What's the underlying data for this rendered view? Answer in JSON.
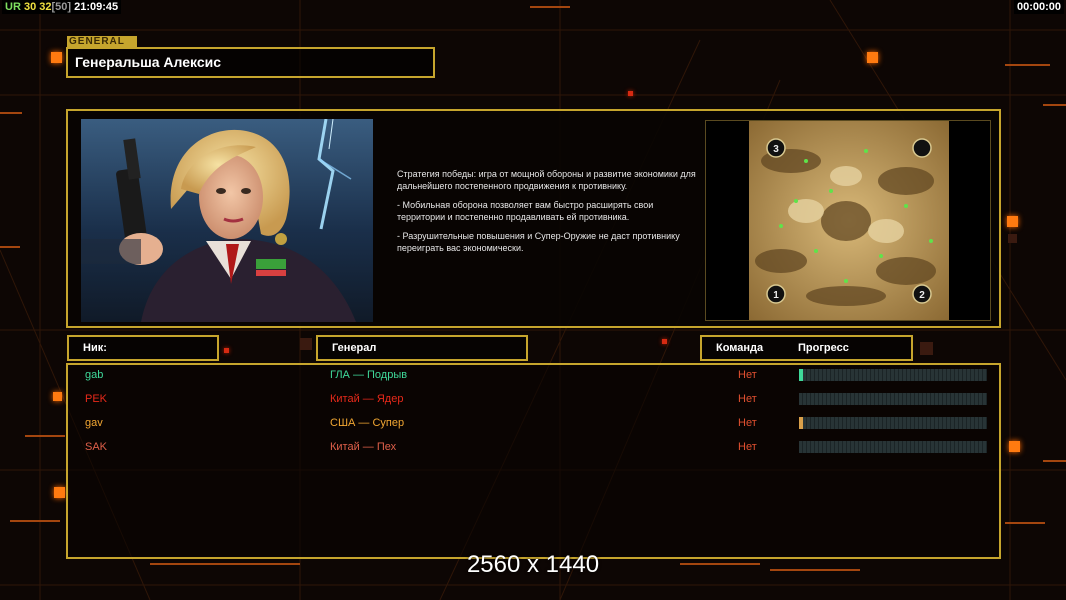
{
  "hud": {
    "left": [
      {
        "text": "UR",
        "cls": "c1"
      },
      {
        "text": " 30",
        "cls": "c2"
      },
      {
        "text": " 32",
        "cls": "c2"
      },
      {
        "text": "[50]",
        "cls": "c3"
      },
      {
        "text": " 21:09:45",
        "cls": "c4"
      }
    ],
    "timer": "00:00:00"
  },
  "general": {
    "tag": "GENERAL",
    "name": "Генеральша Алексис"
  },
  "strategy": [
    "Стратегия победы: игра от мощной обороны и развитие экономики для дальнейшего постепенного продвижения к противнику.",
    "- Мобильная оборона позволяет вам быстро расширять свои территории и постепенно продавливать ей противника.",
    "- Разрушительные повышения и Супер-Оружие не даст противнику переиграть вас экономически."
  ],
  "minimap": {
    "spawns": [
      "3",
      "1",
      "2"
    ]
  },
  "headers": {
    "nick": "Ник:",
    "general": "Генерал",
    "team": "Команда",
    "progress": "Прогресс"
  },
  "players": [
    {
      "nick": "gab",
      "general": "ГЛА — Подрыв",
      "team": "Нет",
      "color": "#3fd99a",
      "progress": 0.02,
      "fill": "#3fd99a"
    },
    {
      "nick": "PEK",
      "general": "Китай — Ядер",
      "team": "Нет",
      "color": "#e8291a",
      "progress": 0.0,
      "fill": "#e8291a"
    },
    {
      "nick": "gav",
      "general": "США — Супер",
      "team": "Нет",
      "color": "#f2a733",
      "progress": 0.02,
      "fill": "#d9a04a"
    },
    {
      "nick": "SAK",
      "general": "Китай — Пех",
      "team": "Нет",
      "color": "#e0604a",
      "progress": 0.0,
      "fill": "#e0604a"
    }
  ],
  "resolution": "2560 x 1440"
}
